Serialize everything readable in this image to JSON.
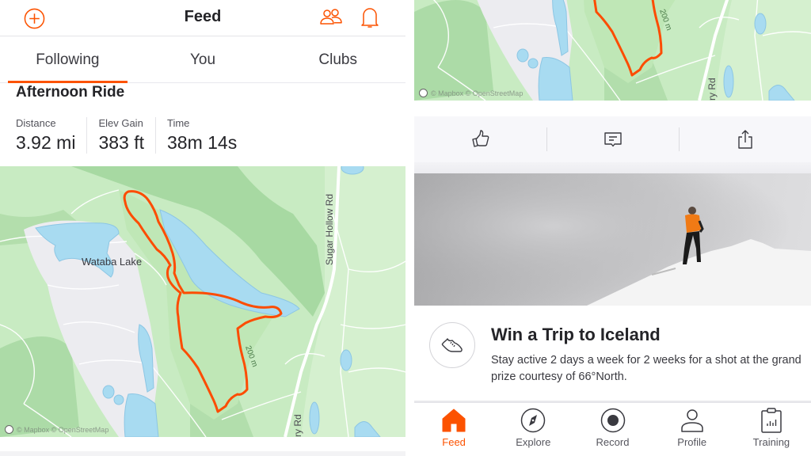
{
  "colors": {
    "accent": "#fc5200",
    "route": "#fc4c02",
    "water": "#a8dbf1",
    "park": "#c2e8bb",
    "text_primary": "#242428",
    "text_secondary": "#52525a"
  },
  "header": {
    "title": "Feed",
    "icons": {
      "left": "add-circle-icon",
      "right": [
        "find-friends-icon",
        "notification-bell-icon"
      ]
    }
  },
  "tabs": [
    {
      "label": "Following",
      "active": true
    },
    {
      "label": "You",
      "active": false
    },
    {
      "label": "Clubs",
      "active": false
    }
  ],
  "activity": {
    "title": "Afternoon Ride",
    "stats": [
      {
        "label": "Distance",
        "value": "3.92 mi"
      },
      {
        "label": "Elev Gain",
        "value": "383 ft"
      },
      {
        "label": "Time",
        "value": "38m 14s"
      }
    ],
    "map": {
      "labels": {
        "lake": "Wataba Lake",
        "road": "Sugar Hollow Rd",
        "road_bottom": "ry Rd",
        "contour": "200 m"
      },
      "attribution": "© Mapbox © OpenStreetMap"
    }
  },
  "actions": [
    {
      "name": "kudos",
      "icon": "thumbs-up-icon"
    },
    {
      "name": "comment",
      "icon": "comment-icon"
    },
    {
      "name": "share",
      "icon": "share-icon"
    }
  ],
  "promo": {
    "icon": "running-shoe-icon",
    "title": "Win a Trip to Iceland",
    "description": "Stay active 2 days a week for 2 weeks for a shot at the grand prize courtesy of 66°North."
  },
  "bottom_nav": [
    {
      "label": "Feed",
      "icon": "home-icon",
      "active": true
    },
    {
      "label": "Explore",
      "icon": "compass-icon",
      "active": false
    },
    {
      "label": "Record",
      "icon": "record-icon",
      "active": false
    },
    {
      "label": "Profile",
      "icon": "profile-icon",
      "active": false
    },
    {
      "label": "Training",
      "icon": "training-clipboard-icon",
      "active": false
    }
  ]
}
